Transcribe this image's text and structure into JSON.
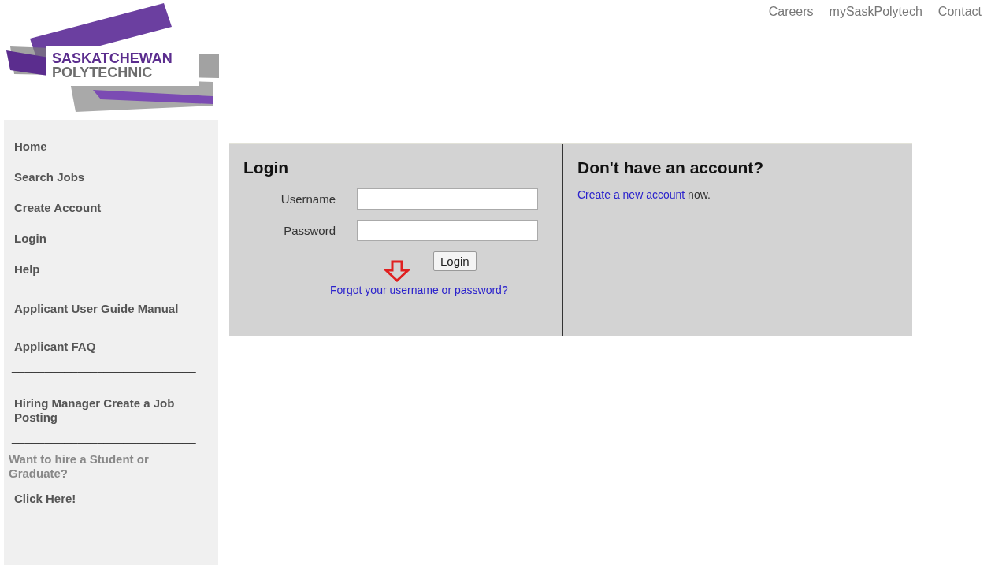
{
  "logo": {
    "line_1": "SASKATCHEWAN",
    "line_2": "POLYTECHNIC"
  },
  "top_nav": [
    "Careers",
    "mySaskPolytech",
    "Contact"
  ],
  "sidebar": {
    "items": [
      {
        "kind": "link",
        "label": "Home"
      },
      {
        "kind": "link",
        "label": "Search Jobs"
      },
      {
        "kind": "link",
        "label": "Create Account"
      },
      {
        "kind": "link",
        "label": "Login"
      },
      {
        "kind": "link",
        "label": "Help"
      },
      {
        "kind": "doc-link",
        "label": "Applicant User Guide Manual"
      },
      {
        "kind": "doc-link",
        "label": "Applicant FAQ"
      },
      {
        "kind": "divider",
        "label": "____________________________"
      },
      {
        "kind": "doc-link",
        "label": "Hiring Manager Create a Job Posting"
      },
      {
        "kind": "divider",
        "label": "____________________________"
      },
      {
        "kind": "note",
        "label": "Want to hire a Student or Graduate?"
      },
      {
        "kind": "link",
        "label": "Click Here!"
      },
      {
        "kind": "divider",
        "label": "____________________________"
      }
    ]
  },
  "login": {
    "title": "Login",
    "fields": [
      {
        "label": "Username"
      },
      {
        "label": "Password"
      }
    ],
    "button": "Login",
    "forgot_link": "Forgot your username or password?"
  },
  "signup": {
    "title": "Don't have an account?",
    "link": "Create a new account",
    "suffix": "now."
  }
}
